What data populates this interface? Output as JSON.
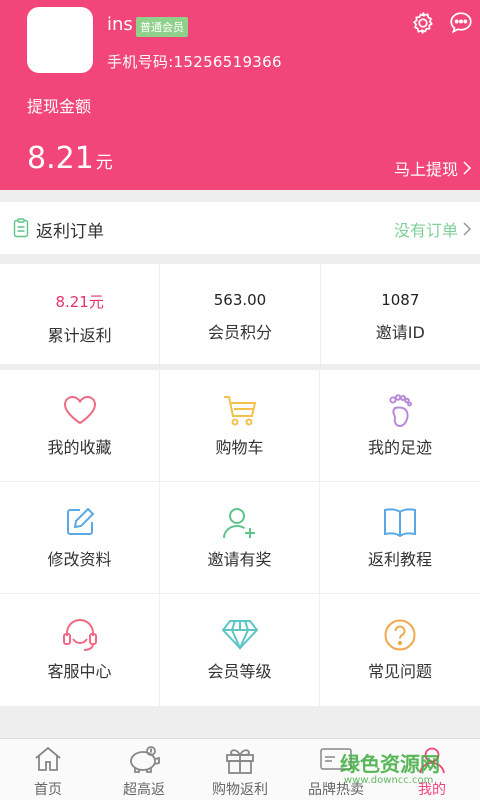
{
  "header": {
    "username": "ins",
    "member_badge": "普通会员",
    "phone_label": "手机号码:15256519366",
    "withdraw_amount_label": "提现金额",
    "amount": "8.21",
    "amount_unit": "元",
    "withdraw_button": "马上提现",
    "bg_color": "#f2467a"
  },
  "orders": {
    "title": "返利订单",
    "status": "没有订单"
  },
  "stats": [
    {
      "value": "8.21元",
      "label": "累计返利"
    },
    {
      "value": "563.00",
      "label": "会员积分"
    },
    {
      "value": "1087",
      "label": "邀请ID"
    }
  ],
  "grid": [
    {
      "label": "我的收藏",
      "icon": "heart-icon",
      "color": "#f06a86"
    },
    {
      "label": "购物车",
      "icon": "cart-icon",
      "color": "#f2c24d"
    },
    {
      "label": "我的足迹",
      "icon": "footprint-icon",
      "color": "#b98bd6"
    },
    {
      "label": "修改资料",
      "icon": "edit-icon",
      "color": "#5aa9e6"
    },
    {
      "label": "邀请有奖",
      "icon": "add-user-icon",
      "color": "#5fc48a"
    },
    {
      "label": "返利教程",
      "icon": "book-icon",
      "color": "#5aa9e6"
    },
    {
      "label": "客服中心",
      "icon": "headset-icon",
      "color": "#f06a86"
    },
    {
      "label": "会员等级",
      "icon": "diamond-icon",
      "color": "#5fc6c6"
    },
    {
      "label": "常见问题",
      "icon": "question-icon",
      "color": "#f2a84d"
    }
  ],
  "nav": [
    {
      "label": "首页",
      "icon": "home-icon"
    },
    {
      "label": "超高返",
      "icon": "piggy-bank-icon"
    },
    {
      "label": "购物返利",
      "icon": "gift-icon"
    },
    {
      "label": "品牌热卖",
      "icon": "brand-icon"
    },
    {
      "label": "我的",
      "icon": "user-icon",
      "active": true
    }
  ],
  "watermark": {
    "text": "绿色资源网",
    "sub": "www.downcc.com"
  }
}
